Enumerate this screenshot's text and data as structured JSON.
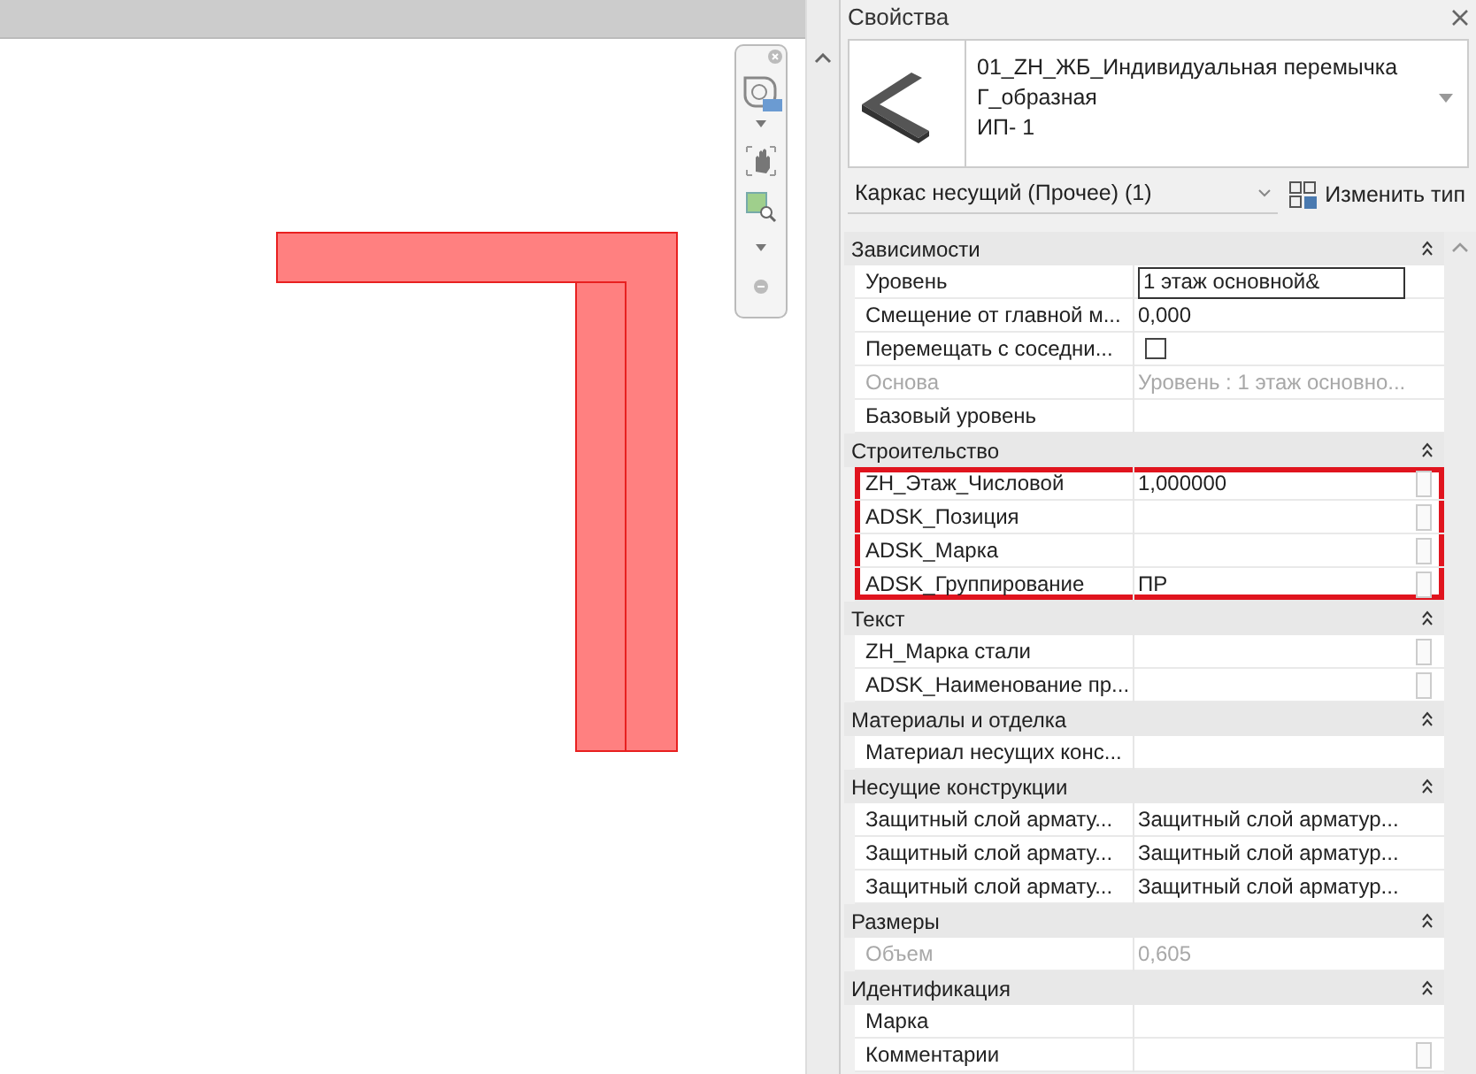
{
  "panel": {
    "title": "Свойства"
  },
  "type_selector": {
    "name_lines": [
      "01_ZH_ЖБ_Индивидуальная перемычка",
      "Г_образная",
      "ИП- 1"
    ]
  },
  "filter": {
    "value": "Каркас несущий (Прочее) (1)",
    "edit_type_button": "Изменить тип"
  },
  "sections": [
    {
      "title": "Зависимости",
      "expanded": true,
      "rows": [
        {
          "kind": "input",
          "label": "Уровень",
          "value": "1 этаж основной&",
          "disabled": false,
          "side_button": false,
          "highlighted": false
        },
        {
          "kind": "text",
          "label": "Смещение от главной м...",
          "value": "0,000",
          "disabled": false,
          "side_button": false,
          "highlighted": false
        },
        {
          "kind": "checkbox",
          "label": "Перемещать с соседни...",
          "checked": false,
          "disabled": false,
          "side_button": false,
          "highlighted": false
        },
        {
          "kind": "text",
          "label": "Основа",
          "value": "Уровень : 1 этаж основно...",
          "disabled": true,
          "side_button": false,
          "highlighted": false
        },
        {
          "kind": "text",
          "label": "Базовый уровень",
          "disabled": false,
          "side_button": false,
          "highlighted": false
        }
      ]
    },
    {
      "title": "Строительство",
      "expanded": true,
      "rows": [
        {
          "kind": "text",
          "label": "ZH_Этаж_Числовой",
          "value": "1,000000",
          "disabled": false,
          "side_button": true,
          "highlighted": true
        },
        {
          "kind": "text",
          "label": "ADSK_Позиция",
          "disabled": false,
          "side_button": true,
          "highlighted": true
        },
        {
          "kind": "text",
          "label": "ADSK_Марка",
          "disabled": false,
          "side_button": true,
          "highlighted": true
        },
        {
          "kind": "text",
          "label": "ADSK_Группирование",
          "value": "ПР",
          "disabled": false,
          "side_button": true,
          "highlighted": true
        }
      ]
    },
    {
      "title": "Текст",
      "expanded": true,
      "rows": [
        {
          "kind": "text",
          "label": "ZH_Марка стали",
          "disabled": false,
          "side_button": true,
          "highlighted": false
        },
        {
          "kind": "text",
          "label": "ADSK_Наименование пр...",
          "disabled": false,
          "side_button": true,
          "highlighted": false
        }
      ]
    },
    {
      "title": "Материалы и отделка",
      "expanded": true,
      "rows": [
        {
          "kind": "text",
          "label": "Материал несущих конс...",
          "disabled": false,
          "side_button": false,
          "highlighted": false
        }
      ]
    },
    {
      "title": "Несущие конструкции",
      "expanded": true,
      "rows": [
        {
          "kind": "text",
          "label": "Защитный слой армату...",
          "value": "Защитный слой арматур...",
          "disabled": false,
          "side_button": false,
          "highlighted": false
        },
        {
          "kind": "text",
          "label": "Защитный слой армату...",
          "value": "Защитный слой арматур...",
          "disabled": false,
          "side_button": false,
          "highlighted": false
        },
        {
          "kind": "text",
          "label": "Защитный слой армату...",
          "value": "Защитный слой арматур...",
          "disabled": false,
          "side_button": false,
          "highlighted": false
        }
      ]
    },
    {
      "title": "Размеры",
      "expanded": true,
      "rows": [
        {
          "kind": "text",
          "label": "Объем",
          "value": "0,605",
          "disabled": true,
          "side_button": false,
          "highlighted": false
        }
      ]
    },
    {
      "title": "Идентификация",
      "expanded": true,
      "rows": [
        {
          "kind": "text",
          "label": "Марка",
          "disabled": false,
          "side_button": false,
          "highlighted": false
        },
        {
          "kind": "text",
          "label": "Комментарии",
          "disabled": false,
          "side_button": true,
          "highlighted": false
        }
      ]
    }
  ]
}
